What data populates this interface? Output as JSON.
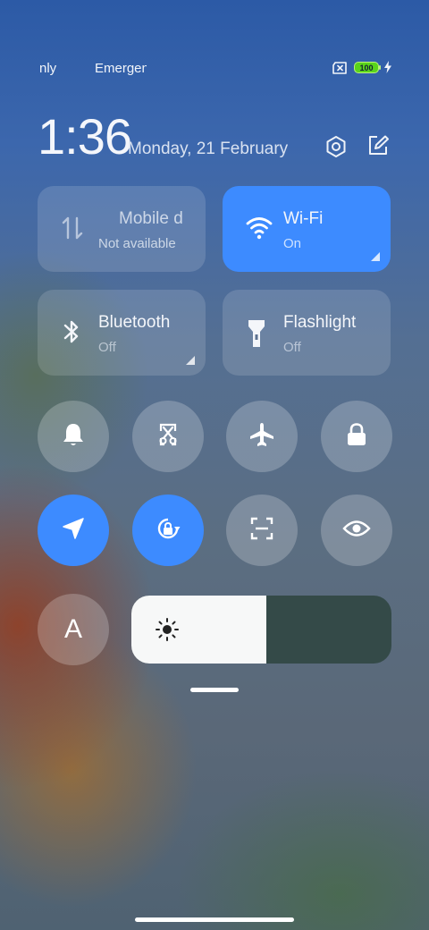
{
  "status_bar": {
    "carrier1": "nly",
    "carrier2": "Emergen",
    "battery_level": "100"
  },
  "header": {
    "time": "1:36",
    "date": "Monday, 21 February"
  },
  "tiles": {
    "mobile_data": {
      "title": "Mobile d",
      "subtitle": "Not available"
    },
    "wifi": {
      "title": "Wi-Fi",
      "subtitle": "On"
    },
    "bluetooth": {
      "title": "Bluetooth",
      "subtitle": "Off"
    },
    "flashlight": {
      "title": "Flashlight",
      "subtitle": "Off"
    }
  },
  "circle_icons": [
    "bell-icon",
    "screenshot-icon",
    "airplane-icon",
    "lock-icon",
    "location-icon",
    "rotation-lock-icon",
    "scan-icon",
    "eye-icon"
  ],
  "brightness": {
    "level": 0.52,
    "auto_label": "A"
  },
  "colors": {
    "accent": "#3d8bff"
  }
}
